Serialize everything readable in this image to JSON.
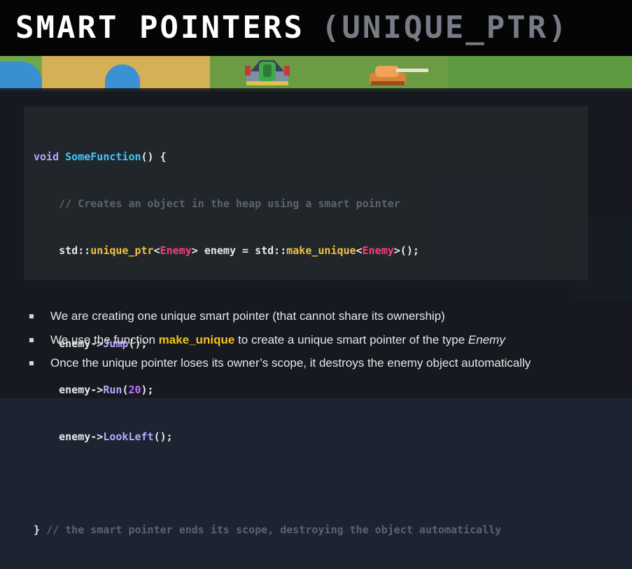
{
  "title": {
    "main": "SMART POINTERS",
    "paren": "(UNIQUE_PTR)"
  },
  "code": {
    "l1_kw": "void",
    "l1_fn": "SomeFunction",
    "l1_rest": "() {",
    "l2_comment": "// Creates an object in the heap using a smart pointer",
    "l3_a": "std::",
    "l3_b": "unique_ptr",
    "l3_c": "<",
    "l3_d": "Enemy",
    "l3_e": "> enemy = std::",
    "l3_f": "make_unique",
    "l3_g": "<",
    "l3_h": "Enemy",
    "l3_i": ">();",
    "l5_a": "enemy->",
    "l5_b": "Jump",
    "l5_c": "();",
    "l6_a": "enemy->",
    "l6_b": "Run",
    "l6_c": "(",
    "l6_d": "20",
    "l6_e": ");",
    "l7_a": "enemy->",
    "l7_b": "LookLeft",
    "l7_c": "();",
    "l9_brace": "}",
    "l9_comment": "// the smart pointer ends its scope, destroying the object automatically"
  },
  "bullets": {
    "b1": "We are creating one unique smart pointer (that cannot share its ownership)",
    "b2_pre": "We use the function ",
    "b2_hl": "make_unique",
    "b2_mid": " to create a unique smart pointer of the type ",
    "b2_em": "Enemy",
    "b3": "Once the unique pointer loses its owner’s scope, it destroys the enemy object automatically"
  },
  "colors": {
    "keyword": "#b9a6ff",
    "function": "#3ec7ff",
    "comment": "#5c636d",
    "type": "#ff3d7a",
    "std_member": "#f0c040",
    "number": "#c06cff",
    "highlight": "#f2c21b"
  },
  "icons": [
    "green-tank-sprite-icon",
    "orange-tank-sprite-icon",
    "bullet-square-icon"
  ]
}
